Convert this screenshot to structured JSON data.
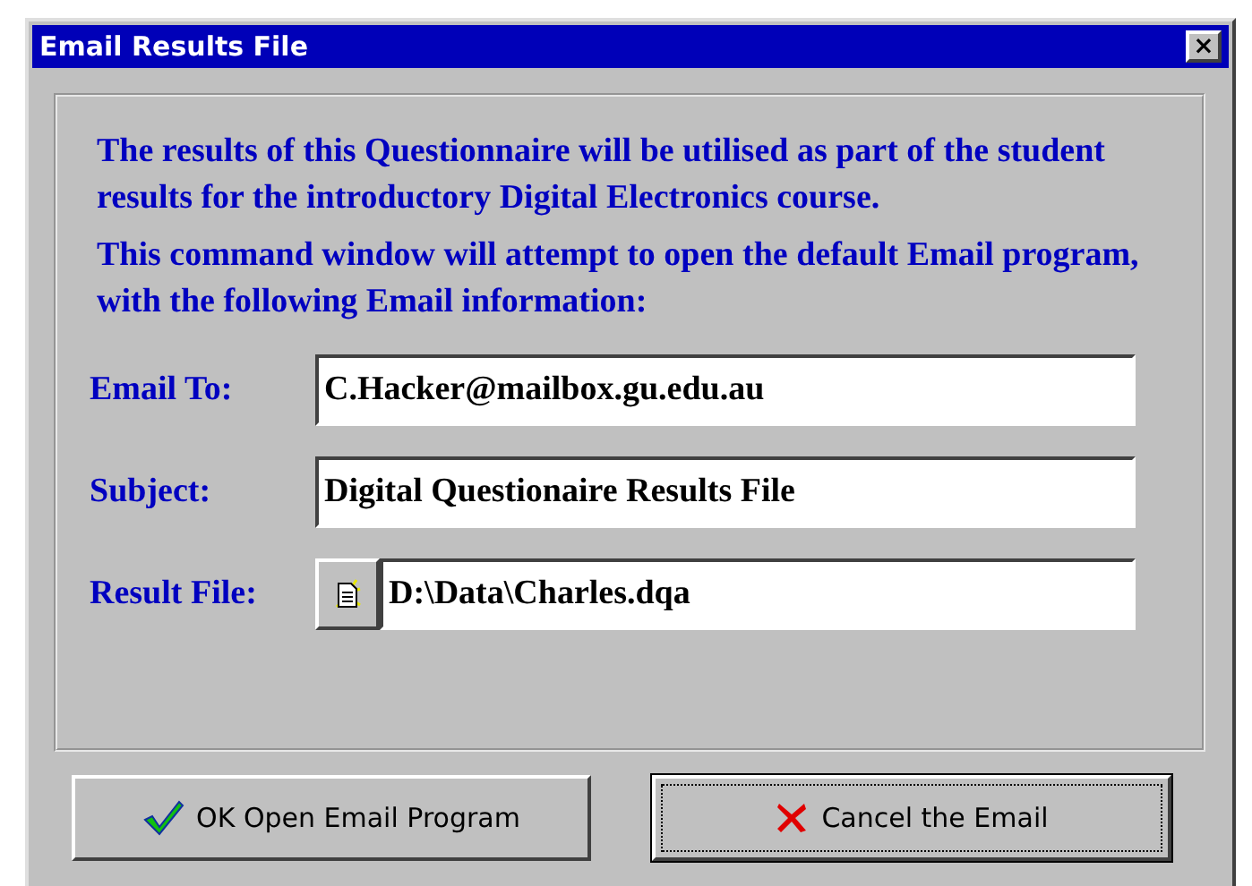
{
  "window": {
    "title": "Email Results File",
    "close": "×"
  },
  "intro": [
    "The results of this Questionnaire will be utilised as part of the student results for the introductory Digital Electronics course.",
    "This command window will attempt to open the default Email program, with the following Email information:"
  ],
  "fields": [
    {
      "kind": "text",
      "label": "Email To:",
      "value": "C.Hacker@mailbox.gu.edu.au"
    },
    {
      "kind": "text",
      "label": "Subject:",
      "value": "Digital Questionaire Results File"
    },
    {
      "kind": "file",
      "label": "Result File:",
      "value": "D:\\Data\\Charles.dqa"
    }
  ],
  "buttons": [
    {
      "kind": "ok",
      "label": "OK Open Email Program",
      "focused": false
    },
    {
      "kind": "cancel",
      "label": "Cancel the Email",
      "focused": true
    }
  ]
}
